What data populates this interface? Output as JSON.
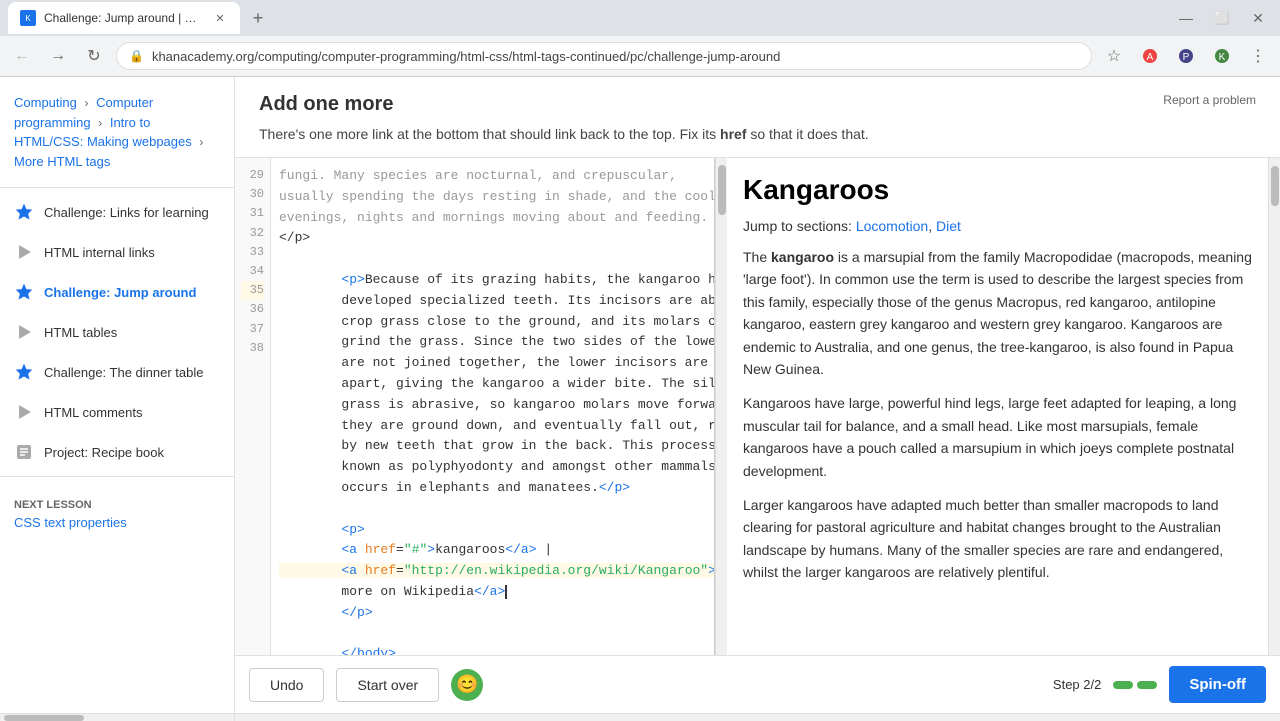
{
  "browser": {
    "tab_title": "Challenge: Jump around | More ...",
    "url": "khanacademy.org/computing/computer-programming/html-css/html-tags-continued/pc/challenge-jump-around",
    "favicon_text": "K"
  },
  "breadcrumb": {
    "items": [
      {
        "label": "Computing",
        "href": "#"
      },
      {
        "label": "Computer programming",
        "href": "#"
      },
      {
        "label": "Intro to HTML/CSS: Making webpages",
        "href": "#"
      },
      {
        "label": "More HTML tags",
        "href": "#"
      }
    ]
  },
  "sidebar": {
    "items": [
      {
        "id": "links-for-learning",
        "label": "Challenge: Links for learning",
        "icon": "star",
        "active": false
      },
      {
        "id": "html-internal-links",
        "label": "HTML internal links",
        "icon": "play",
        "active": false
      },
      {
        "id": "challenge-jump-around",
        "label": "Challenge: Jump around",
        "icon": "star",
        "active": true
      },
      {
        "id": "html-tables",
        "label": "HTML tables",
        "icon": "play",
        "active": false
      },
      {
        "id": "challenge-dinner-table",
        "label": "Challenge: The dinner table",
        "icon": "star",
        "active": false
      },
      {
        "id": "html-comments",
        "label": "HTML comments",
        "icon": "play",
        "active": false
      },
      {
        "id": "project-recipe-book",
        "label": "Project: Recipe book",
        "icon": "project",
        "active": false
      }
    ],
    "next_lesson_label": "Next lesson",
    "next_lesson_name": "CSS text properties"
  },
  "content": {
    "title": "Add one more",
    "description": "There's one more link at the bottom that should link back to the top. Fix its",
    "description_bold": "href",
    "description_end": "so that it does that.",
    "report_link": "Report a problem"
  },
  "code_editor": {
    "lines": [
      {
        "num": "30",
        "code": ""
      },
      {
        "num": "31",
        "code": "        <p>Because of its grazing habits, the kangaroo has\n        developed specialized teeth. Its incisors are able to\n        crop grass close to the ground, and its molars chop and\n        grind the grass. Since the two sides of the lower jaw\n        are not joined together, the lower incisors are farther\n        apart, giving the kangaroo a wider bite. The silica in\n        grass is abrasive, so kangaroo molars move forward as\n        they are ground down, and eventually fall out, replaced\n        by new teeth that grow in the back. This process is\n        known as polyphyodonty and amongst other mammals, only\n        occurs in elephants and manatees.</p>"
      },
      {
        "num": "32",
        "code": ""
      },
      {
        "num": "33",
        "code": "        <p>"
      },
      {
        "num": "34",
        "code": "        <a href=\"#\">kangaroos</a> |"
      },
      {
        "num": "35",
        "code": "        <a href=\"http://en.wikipedia.org/wiki/Kangaroo\">Read\n        more on Wikipedia</a>"
      },
      {
        "num": "36",
        "code": "        </p>"
      },
      {
        "num": "37",
        "code": ""
      },
      {
        "num": "38",
        "code": "    </body>"
      }
    ],
    "buttons": {
      "undo": "Undo",
      "start_over": "Start over"
    }
  },
  "step_indicator": {
    "label": "Step 2/2",
    "current": 2,
    "total": 2
  },
  "spinoff_button": "Spin-off",
  "preview": {
    "title": "Kangaroos",
    "jump_label": "Jump to sections:",
    "jump_links": [
      {
        "label": "Locomotion",
        "href": "#"
      },
      {
        "label": "Diet",
        "href": "#"
      }
    ],
    "paragraphs": [
      "The kangaroo is a marsupial from the family Macropodidae (macropods, meaning 'large foot'). In common use the term is used to describe the largest species from this family, especially those of the genus Macropus, red kangaroo, antilopine kangaroo, eastern grey kangaroo and western grey kangaroo. Kangaroos are endemic to Australia, and one genus, the tree-kangaroo, is also found in Papua New Guinea.",
      "Kangaroos have large, powerful hind legs, large feet adapted for leaping, a long muscular tail for balance, and a small head. Like most marsupials, female kangaroos have a pouch called a marsupium in which joeys complete postnatal development.",
      "Larger kangaroos have adapted much better than smaller macropods to land clearing for pastoral agriculture and habitat changes brought to the Australian landscape by humans. Many of the smaller species are rare and endangered, whilst the larger kangaroos are relatively plentiful."
    ]
  }
}
